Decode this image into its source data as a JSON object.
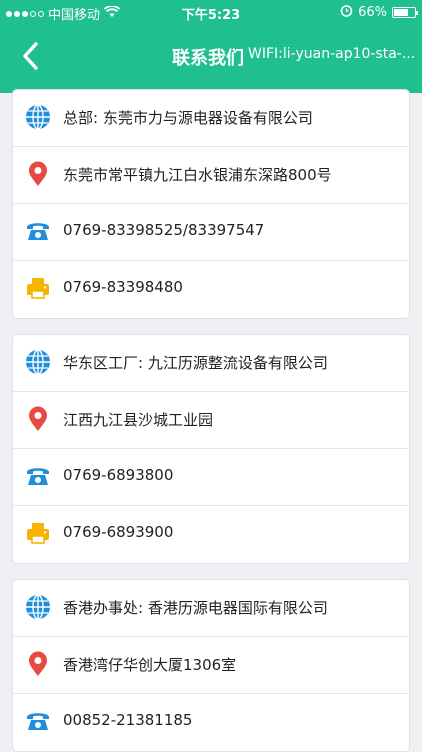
{
  "status_bar": {
    "carrier": "中国移动",
    "time": "下午5:23",
    "battery": "66%"
  },
  "nav": {
    "title": "联系我们",
    "wifi": "WIFI:li-yuan-ap10-sta-..."
  },
  "colors": {
    "brand": "#20bf8f",
    "globe": "#1f8fdc",
    "pin": "#e84a43",
    "phone": "#1f8fdc",
    "fax": "#f6b400"
  },
  "cards": [
    {
      "rows": [
        {
          "icon": "globe-icon",
          "text": "总部: 东莞市力与源电器设备有限公司"
        },
        {
          "icon": "location-pin-icon",
          "text": "东莞市常平镇九江白水银浦东深路800号"
        },
        {
          "icon": "phone-icon",
          "text": "0769-83398525/83397547"
        },
        {
          "icon": "fax-icon",
          "text": "0769-83398480"
        }
      ]
    },
    {
      "rows": [
        {
          "icon": "globe-icon",
          "text": "华东区工厂: 九江历源整流设备有限公司"
        },
        {
          "icon": "location-pin-icon",
          "text": "江西九江县沙城工业园"
        },
        {
          "icon": "phone-icon",
          "text": "0769-6893800"
        },
        {
          "icon": "fax-icon",
          "text": "0769-6893900"
        }
      ]
    },
    {
      "rows": [
        {
          "icon": "globe-icon",
          "text": "香港办事处: 香港历源电器国际有限公司"
        },
        {
          "icon": "location-pin-icon",
          "text": "香港湾仔华创大厦1306室"
        },
        {
          "icon": "phone-icon",
          "text": "00852-21381185"
        }
      ]
    }
  ]
}
